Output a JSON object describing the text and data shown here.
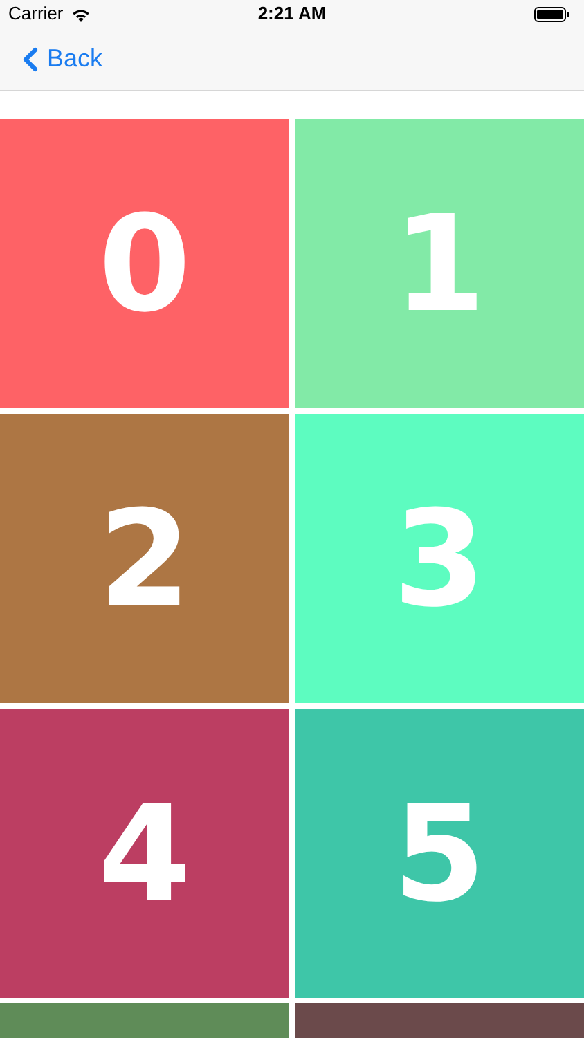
{
  "status_bar": {
    "carrier": "Carrier",
    "time": "2:21 AM"
  },
  "nav_bar": {
    "back": "Back"
  },
  "tiles": [
    {
      "label": "0",
      "color": "#fe6266"
    },
    {
      "label": "1",
      "color": "#82eaa7"
    },
    {
      "label": "2",
      "color": "#ad7644"
    },
    {
      "label": "3",
      "color": "#5dfcc0"
    },
    {
      "label": "4",
      "color": "#bc3e62"
    },
    {
      "label": "5",
      "color": "#3ec6a8"
    },
    {
      "color": "#5f8c58"
    },
    {
      "color": "#6b4a4b"
    }
  ]
}
